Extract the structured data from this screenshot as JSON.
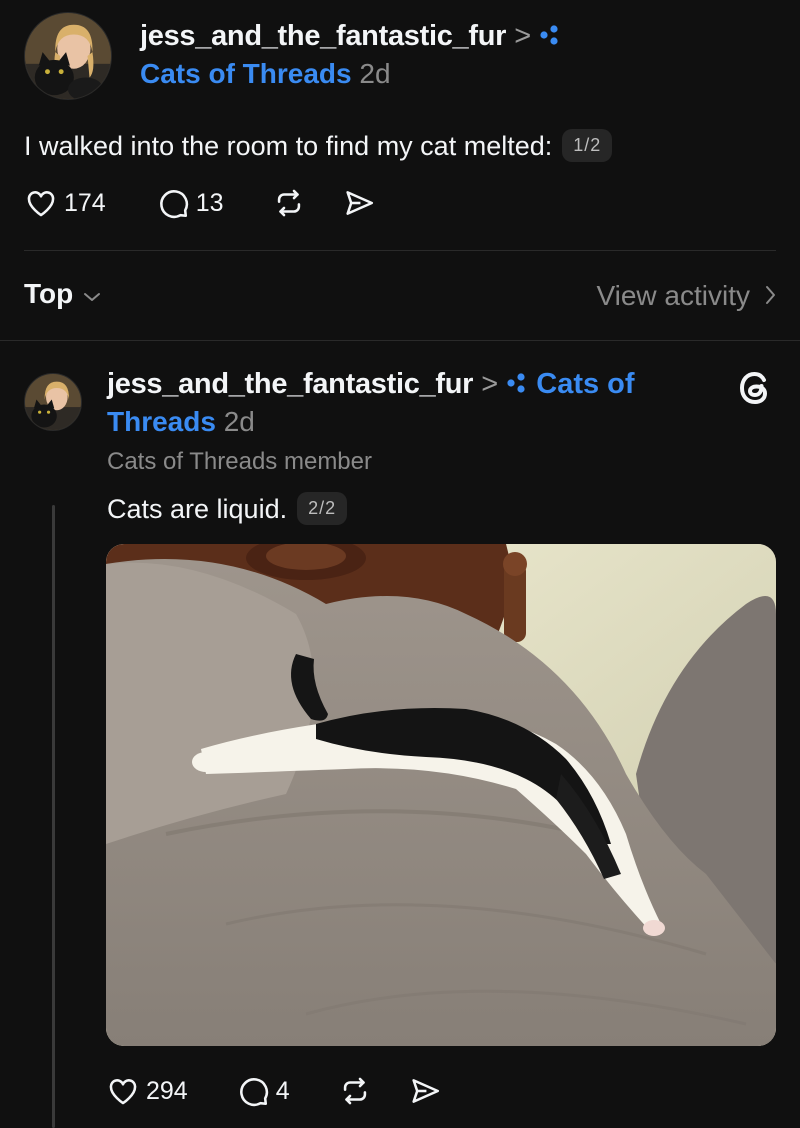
{
  "post": {
    "username": "jess_and_the_fantastic_fur",
    "chevron": ">",
    "community": "Cats of Threads",
    "age": "2d",
    "text": "I walked into the room to find my cat melted:",
    "pager": "1/2",
    "likes": "174",
    "replies": "13"
  },
  "sort": {
    "label": "Top",
    "view_activity": "View activity"
  },
  "reply": {
    "username": "jess_and_the_fantastic_fur",
    "chevron": ">",
    "community_part1": "Cats of",
    "community_part2": "Threads",
    "age": "2d",
    "membership": "Cats of Threads member",
    "text": "Cats are liquid.",
    "pager": "2/2",
    "likes": "294",
    "replies": "4"
  },
  "colors": {
    "background": "#101010",
    "text": "#f3f5f7",
    "accent": "#3a8bf2",
    "muted": "#8a8a8a"
  },
  "icons": [
    "heart-icon",
    "comment-icon",
    "repost-icon",
    "share-icon",
    "community-dots-icon",
    "threads-logo-icon",
    "chevron-down-icon",
    "chevron-right-icon"
  ]
}
